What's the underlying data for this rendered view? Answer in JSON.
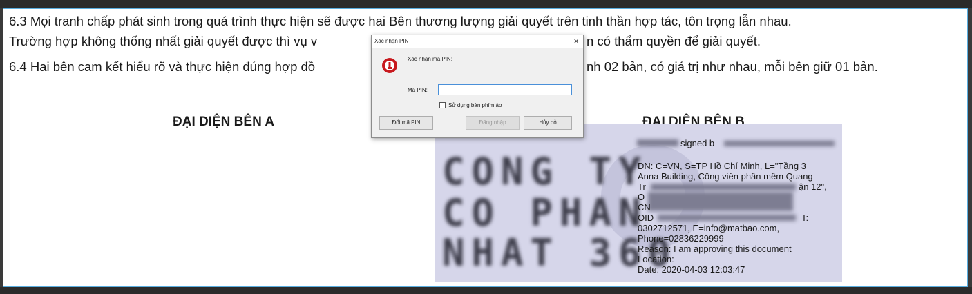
{
  "document": {
    "lines": [
      "6.3 Mọi tranh chấp phát sinh trong quá trình thực hiện sẽ được hai Bên thương lượng giải quyết trên tinh thần hợp tác, tôn trọng lẫn nhau.",
      "Trường hợp không thống nhất giải quyết được thì vụ v",
      "n có thẩm quyền để giải quyết.",
      "6.4 Hai bên cam kết hiểu rõ và thực hiện đúng hợp đồ",
      "nh 02 bản, có giá trị như nhau, mỗi bên giữ 01 bản."
    ],
    "rep_a": "ĐẠI DIỆN BÊN A",
    "rep_b": "ĐẠI DIỆN BÊN B"
  },
  "signature": {
    "signed_by": "signed b",
    "dn_lines": [
      "DN: C=VN, S=TP Hồ Chí Minh, L=\"Tầng 3",
      "Anna Building, Công viên phần mềm Quang",
      "Tr",
      "O",
      "CN",
      "OID",
      "0302712571, E=info@matbao.com,",
      "Phone=02836229999",
      "Reason: I am approving this document",
      "Location:",
      "Date: 2020-04-03 12:03:47"
    ],
    "line2_tail": "ận 12\",",
    "oid_tail": "T:"
  },
  "dialog": {
    "title": "Xác nhận PIN",
    "close_glyph": "×",
    "prompt": "Xác nhận mã PIN:",
    "pin_label": "Mã PIN:",
    "pin_value": "",
    "virtual_keyboard_label": "Sử dụng bàn phím ảo",
    "buttons": {
      "change_pin": "Đổi mã PIN",
      "login": "Đăng nhập",
      "cancel": "Hủy bỏ"
    }
  }
}
